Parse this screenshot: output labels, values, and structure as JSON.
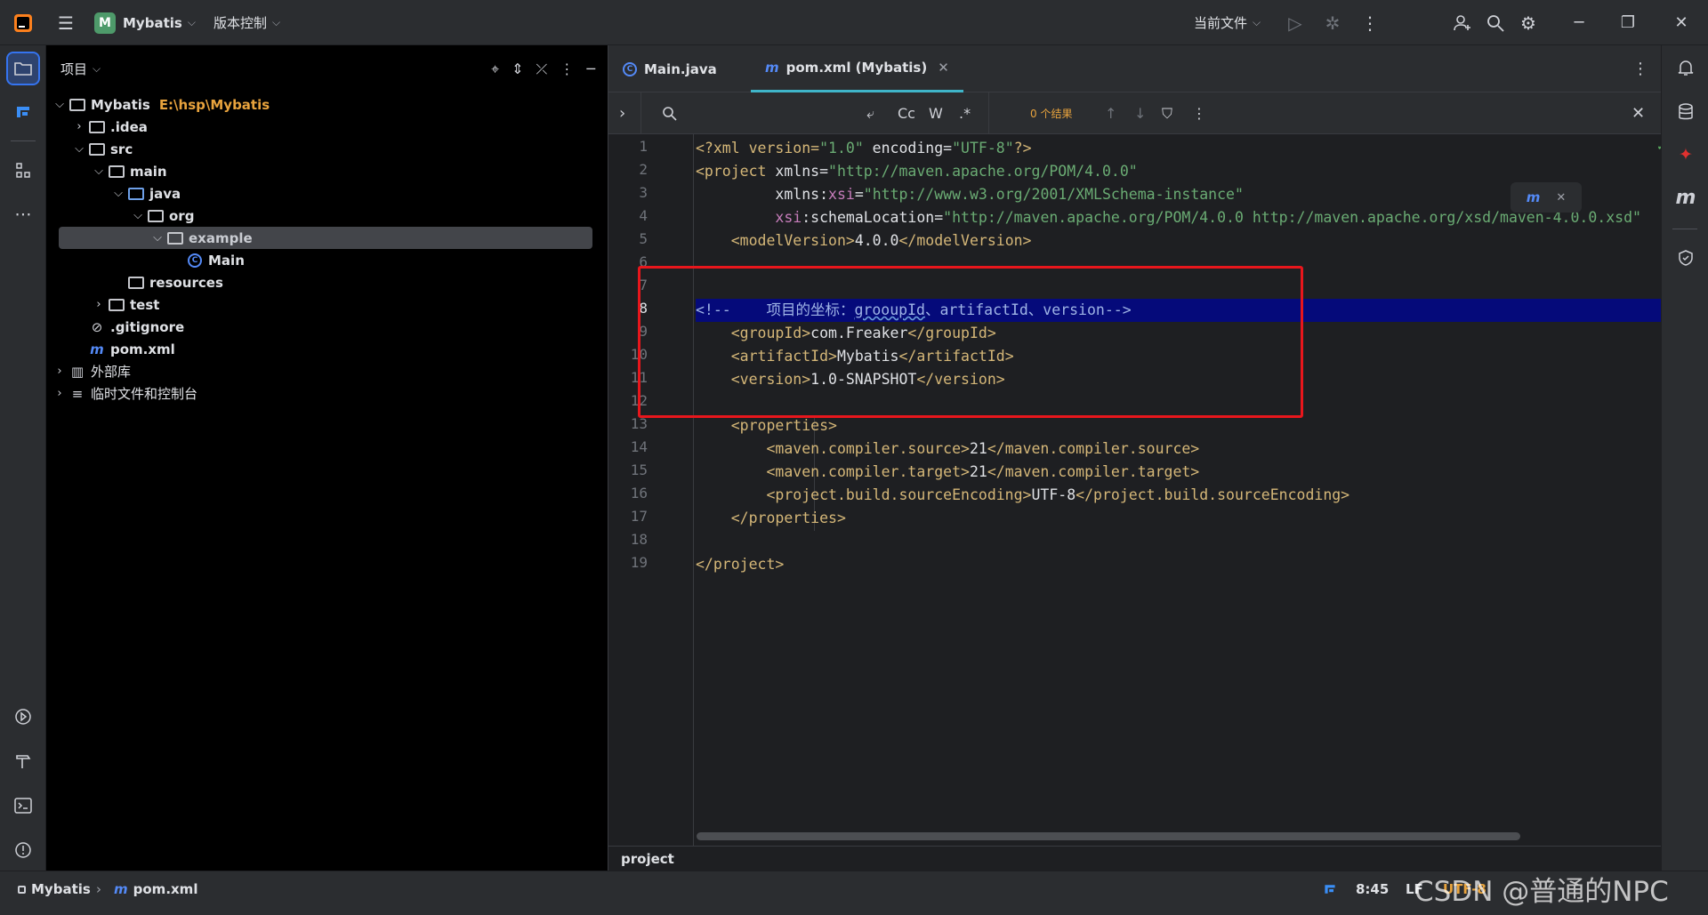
{
  "titlebar": {
    "project_badge": "M",
    "project_name": "Mybatis",
    "vcs_label": "版本控制",
    "run_config": "当前文件"
  },
  "project_panel": {
    "title": "项目",
    "tree": [
      {
        "label": "Mybatis",
        "path": "E:\\hsp\\Mybatis"
      },
      {
        "label": ".idea"
      },
      {
        "label": "src"
      },
      {
        "label": "main"
      },
      {
        "label": "java"
      },
      {
        "label": "org"
      },
      {
        "label": "example"
      },
      {
        "label": "Main"
      },
      {
        "label": "resources"
      },
      {
        "label": "test"
      },
      {
        "label": ".gitignore"
      },
      {
        "label": "pom.xml"
      },
      {
        "label": "外部库"
      },
      {
        "label": "临时文件和控制台"
      }
    ]
  },
  "editor": {
    "tabs": [
      {
        "label": "Main.java"
      },
      {
        "label": "pom.xml (Mybatis)"
      }
    ],
    "search": {
      "results": "0 个结果",
      "opt_case": "Cc",
      "opt_word": "W",
      "opt_regex": ".*"
    },
    "problems_count": "1",
    "current_line": 8,
    "line_numbers": [
      "1",
      "2",
      "3",
      "4",
      "5",
      "6",
      "7",
      "8",
      "9",
      "10",
      "11",
      "12",
      "13",
      "14",
      "15",
      "16",
      "17",
      "18",
      "19"
    ],
    "code": {
      "l1": {
        "a": "<?xml version=",
        "b": "\"1.0\"",
        "c": " encoding=",
        "d": "\"UTF-8\"",
        "e": "?>"
      },
      "l2": {
        "a": "<project ",
        "b": "xmlns=",
        "c": "\"http://maven.apache.org/POM/4.0.0\""
      },
      "l3": {
        "a": "         xmlns:",
        "b": "xsi",
        "c": "=",
        "d": "\"http://www.w3.org/2001/XMLSchema-instance\""
      },
      "l4": {
        "a": "         ",
        "b": "xsi",
        "c": ":schemaLocation=",
        "d": "\"http://maven.apache.org/POM/4.0.0 http://maven.apache.org/xsd/maven-4.0.0.xsd\""
      },
      "l5": {
        "a": "    <modelVersion>",
        "b": "4.0.0",
        "c": "</modelVersion>"
      },
      "l8": {
        "a": "<!--    项目的坐标：",
        "b": "grooupId",
        "c": "、artifactId、version-->"
      },
      "l9": {
        "a": "    <groupId>",
        "b": "com.Freaker",
        "c": "</groupId>"
      },
      "l10": {
        "a": "    <artifactId>",
        "b": "Mybatis",
        "c": "</artifactId>"
      },
      "l11": {
        "a": "    <version>",
        "b": "1.0-SNAPSHOT",
        "c": "</version>"
      },
      "l13": {
        "a": "    <properties>"
      },
      "l14": {
        "a": "        <maven.compiler.source>",
        "b": "21",
        "c": "</maven.compiler.source>"
      },
      "l15": {
        "a": "        <maven.compiler.target>",
        "b": "21",
        "c": "</maven.compiler.target>"
      },
      "l16": {
        "a": "        <project.build.sourceEncoding>",
        "b": "UTF-8",
        "c": "</project.build.sourceEncoding>"
      },
      "l17": {
        "a": "    </properties>"
      },
      "l19": {
        "a": "</project>"
      }
    },
    "breadcrumb": "project"
  },
  "statusbar": {
    "project": "Mybatis",
    "file": "pom.xml",
    "position": "8:45",
    "line_sep": "LF",
    "encoding": "UTF-8"
  },
  "watermark": "CSDN @普通的NPC",
  "colors": {
    "accent": "#3574f0",
    "tab_underline": "#3fb5c9",
    "highlight_line": "#050a7a",
    "annotation_box": "#e8161c",
    "xml_tag": "#d5b778",
    "xml_string": "#6aab73",
    "xml_namespace": "#c77dbb"
  }
}
